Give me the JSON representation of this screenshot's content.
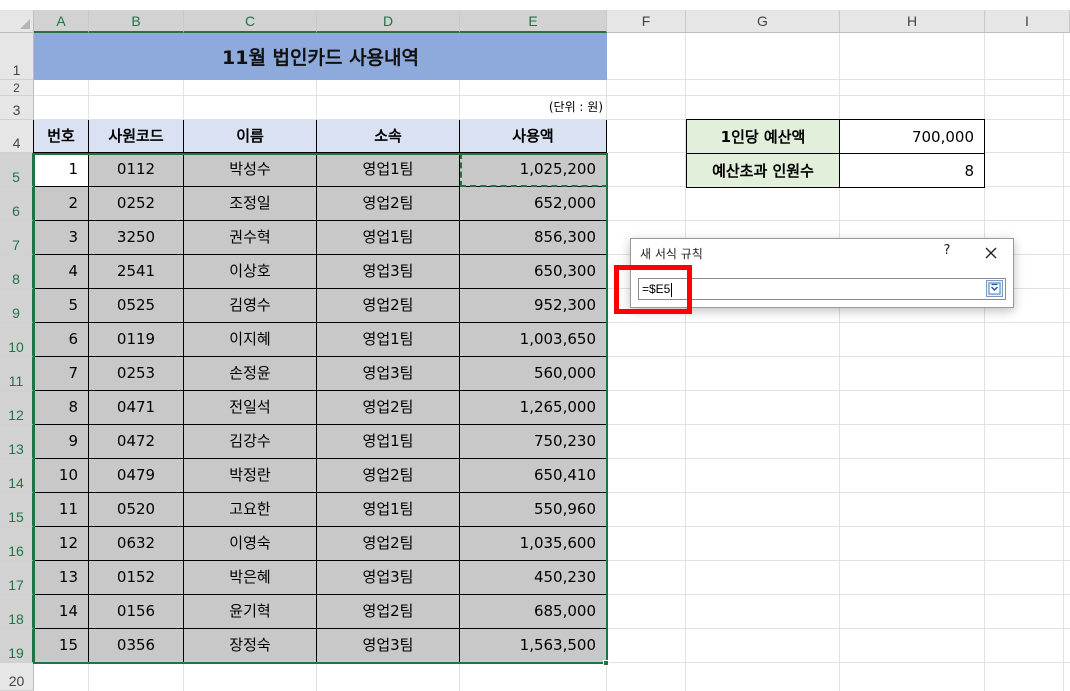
{
  "columns": [
    "A",
    "B",
    "C",
    "D",
    "E",
    "F",
    "G",
    "H",
    "I"
  ],
  "rows": [
    "1",
    "2",
    "3",
    "4",
    "5",
    "6",
    "7",
    "8",
    "9",
    "10",
    "11",
    "12",
    "13",
    "14",
    "15",
    "16",
    "17",
    "18",
    "19",
    "20"
  ],
  "sheet": {
    "title": "11월 법인카드 사용내역",
    "unit_note": "(단위 : 원)",
    "headers": [
      "번호",
      "사원코드",
      "이름",
      "소속",
      "사용액"
    ],
    "records": [
      [
        "1",
        "0112",
        "박성수",
        "영업1팀",
        "1,025,200"
      ],
      [
        "2",
        "0252",
        "조정일",
        "영업2팀",
        "652,000"
      ],
      [
        "3",
        "3250",
        "권수혁",
        "영업1팀",
        "856,300"
      ],
      [
        "4",
        "2541",
        "이상호",
        "영업3팀",
        "650,300"
      ],
      [
        "5",
        "0525",
        "김영수",
        "영업2팀",
        "952,300"
      ],
      [
        "6",
        "0119",
        "이지혜",
        "영업1팀",
        "1,003,650"
      ],
      [
        "7",
        "0253",
        "손정윤",
        "영업3팀",
        "560,000"
      ],
      [
        "8",
        "0471",
        "전일석",
        "영업2팀",
        "1,265,000"
      ],
      [
        "9",
        "0472",
        "김강수",
        "영업1팀",
        "750,230"
      ],
      [
        "10",
        "0479",
        "박정란",
        "영업2팀",
        "650,410"
      ],
      [
        "11",
        "0520",
        "고요한",
        "영업1팀",
        "550,960"
      ],
      [
        "12",
        "0632",
        "이영숙",
        "영업2팀",
        "1,035,600"
      ],
      [
        "13",
        "0152",
        "박은혜",
        "영업3팀",
        "450,230"
      ],
      [
        "14",
        "0156",
        "윤기혁",
        "영업2팀",
        "685,000"
      ],
      [
        "15",
        "0356",
        "장정숙",
        "영업3팀",
        "1,563,500"
      ]
    ],
    "budget_label": "1인당 예산액",
    "budget_value": "700,000",
    "over_label": "예산초과 인원수",
    "over_value": "8"
  },
  "dialog": {
    "title": "새 서식 규칙",
    "help": "?",
    "formula": "=$E5"
  },
  "colors": {
    "title_fill": "#8ea9db",
    "header_fill": "#d9e1f2",
    "body_fill": "#c8c8c8",
    "side_label_fill": "#e2efda",
    "selection": "#217346",
    "highlight": "#ff0000"
  }
}
